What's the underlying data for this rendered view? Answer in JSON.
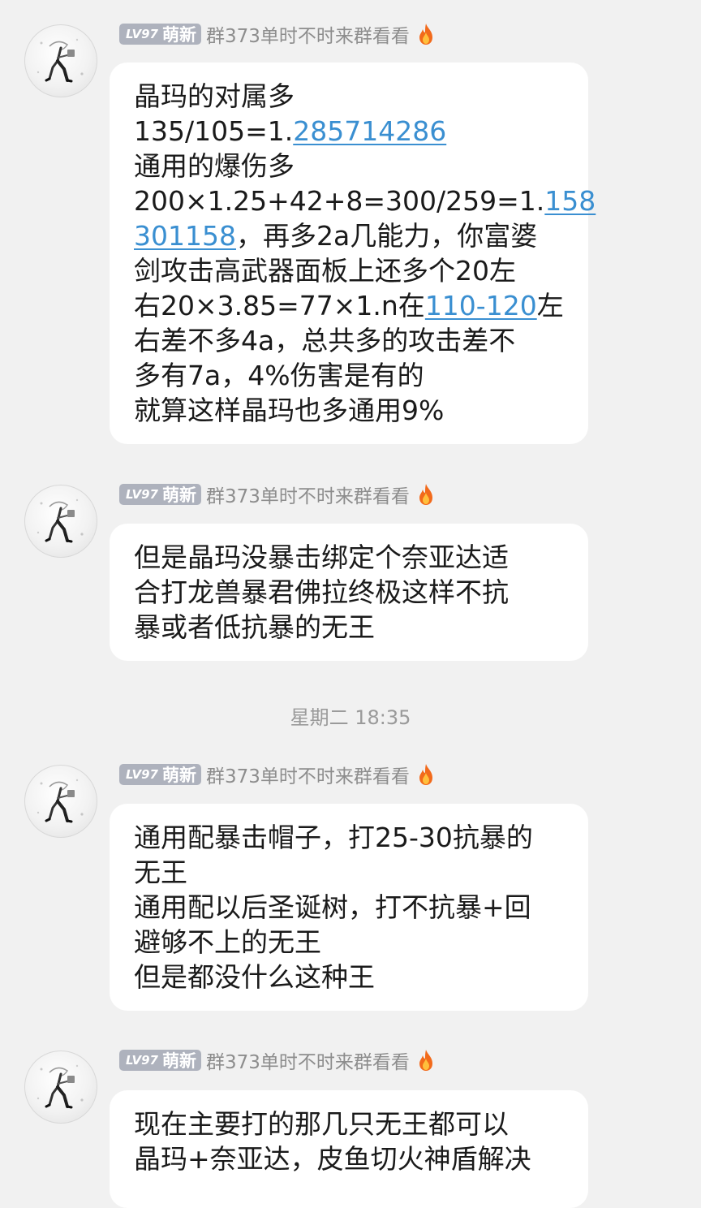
{
  "sender": {
    "level": "LV97",
    "title": "萌新",
    "group_name": "群373单时不时来群看看",
    "avatar_icon": "anime-character-avatar",
    "badge_icon": "fire-icon"
  },
  "messages": [
    {
      "lines": [
        [
          {
            "t": "晶玛的对属多"
          }
        ],
        [
          {
            "t": "135/105=1."
          },
          {
            "t": "285714286",
            "link": true
          }
        ],
        [
          {
            "t": "通用的爆伤多"
          }
        ],
        [
          {
            "t": "200×1.25+42+8=300/259=1."
          },
          {
            "t": "158",
            "link": true
          }
        ],
        [
          {
            "t": "301158",
            "link": true
          },
          {
            "t": "，再多2a几能力，你富婆"
          }
        ],
        [
          {
            "t": "剑攻击高武器面板上还多个20左"
          }
        ],
        [
          {
            "t": "右20×3.85=77×1.n在"
          },
          {
            "t": "110-120",
            "link": true
          },
          {
            "t": "左"
          }
        ],
        [
          {
            "t": "右差不多4a，总共多的攻击差不"
          }
        ],
        [
          {
            "t": "多有7a，4%伤害是有的"
          }
        ],
        [
          {
            "t": "就算这样晶玛也多通用9%"
          }
        ]
      ]
    },
    {
      "lines": [
        [
          {
            "t": "但是晶玛没暴击绑定个奈亚达适"
          }
        ],
        [
          {
            "t": "合打龙兽暴君佛拉终极这样不抗"
          }
        ],
        [
          {
            "t": "暴或者低抗暴的无王"
          }
        ]
      ]
    },
    {
      "lines": [
        [
          {
            "t": "通用配暴击帽子，打25-30抗暴的"
          }
        ],
        [
          {
            "t": "无王"
          }
        ],
        [
          {
            "t": "通用配以后圣诞树，打不抗暴+回"
          }
        ],
        [
          {
            "t": "避够不上的无王"
          }
        ],
        [
          {
            "t": "但是都没什么这种王"
          }
        ]
      ]
    },
    {
      "lines": [
        [
          {
            "t": "现在主要打的那几只无王都可以"
          }
        ],
        [
          {
            "t": "晶玛+奈亚达，皮鱼切火神盾解决"
          }
        ]
      ]
    }
  ],
  "timestamp": "星期二 18:35",
  "colors": {
    "background": "#f1f1f1",
    "bubble": "#ffffff",
    "link": "#3a8fd1",
    "badge": "#aeb2bd",
    "meta_text": "#8d8d8d"
  }
}
